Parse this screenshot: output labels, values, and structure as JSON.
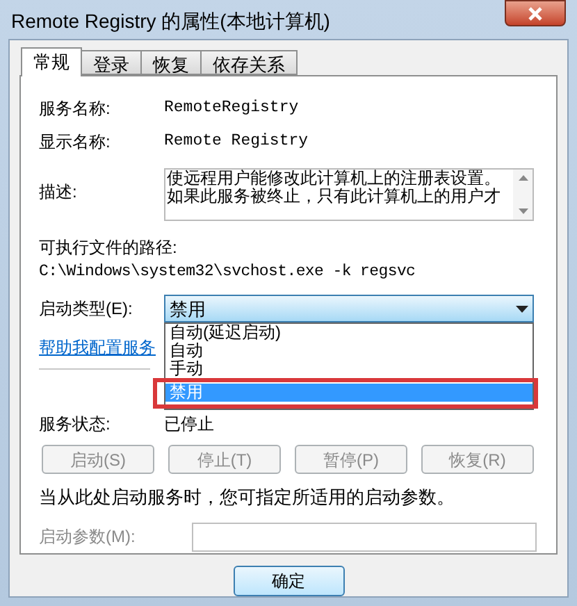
{
  "window": {
    "title": "Remote Registry 的属性(本地计算机)"
  },
  "tabs": [
    {
      "label": "常规",
      "selected": true
    },
    {
      "label": "登录",
      "selected": false
    },
    {
      "label": "恢复",
      "selected": false
    },
    {
      "label": "依存关系",
      "selected": false
    }
  ],
  "fields": [
    {
      "label": "服务名称:",
      "value": "RemoteRegistry"
    },
    {
      "label": "显示名称:",
      "value": "Remote Registry"
    }
  ],
  "description": {
    "label": "描述:",
    "lines": [
      "使远程用户能修改此计算机上的注册表设置。",
      "如果此服务被终止，只有此计算机上的用户才"
    ]
  },
  "path": {
    "label": "可执行文件的路径:",
    "value": "C:\\Windows\\system32\\svchost.exe -k regsvc"
  },
  "startup_type": {
    "label": "启动类型(E):",
    "value": "禁用",
    "expanded": true,
    "options": [
      {
        "label": "自动(延迟启动)",
        "selected": false,
        "highlighted": false
      },
      {
        "label": "自动",
        "selected": false,
        "highlighted": false
      },
      {
        "label": "手动",
        "selected": false,
        "highlighted": false
      },
      {
        "label": "禁用",
        "selected": true,
        "highlighted": true
      }
    ]
  },
  "help_link": "帮助我配置服务",
  "service_status": {
    "label": "服务状态:",
    "value": "已停止"
  },
  "service_buttons": [
    {
      "label": "启动(S)",
      "disabled": true
    },
    {
      "label": "停止(T)",
      "disabled": true
    },
    {
      "label": "暂停(P)",
      "disabled": true
    },
    {
      "label": "恢复(R)",
      "disabled": true
    }
  ],
  "hint": "当从此处启动服务时，您可指定所适用的启动参数。",
  "start_params": {
    "label": "启动参数(M):",
    "disabled": true
  },
  "dialog_buttons": [
    {
      "label": "确定"
    }
  ]
}
